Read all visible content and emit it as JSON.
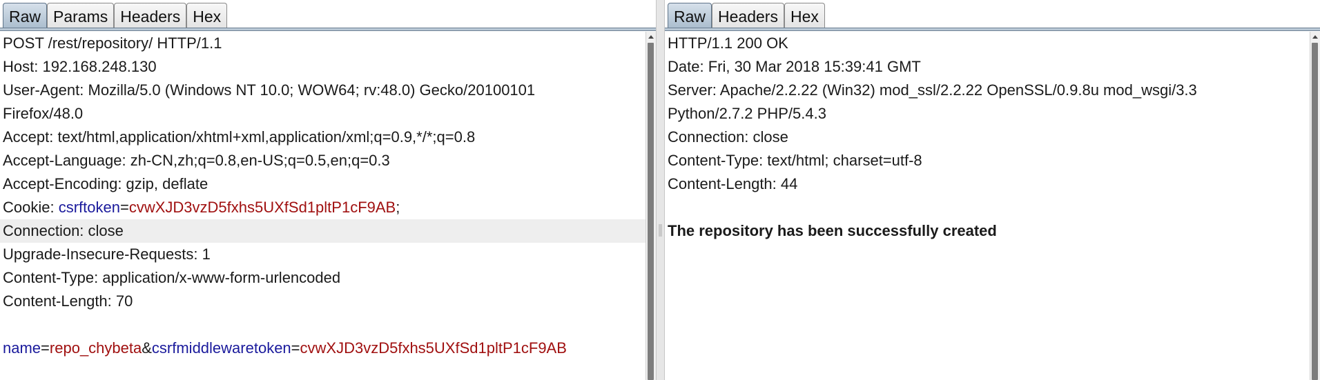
{
  "request": {
    "tabs": [
      "Raw",
      "Params",
      "Headers",
      "Hex"
    ],
    "active_tab": "Raw",
    "lines": {
      "request_line": "POST /rest/repository/ HTTP/1.1",
      "host": "Host: 192.168.248.130",
      "user_agent": "User-Agent: Mozilla/5.0 (Windows NT 10.0; WOW64; rv:48.0) Gecko/20100101",
      "user_agent_cont": "Firefox/48.0",
      "accept": "Accept: text/html,application/xhtml+xml,application/xml;q=0.9,*/*;q=0.8",
      "accept_language": "Accept-Language: zh-CN,zh;q=0.8,en-US;q=0.5,en;q=0.3",
      "accept_encoding": "Accept-Encoding: gzip, deflate",
      "cookie_prefix": "Cookie: ",
      "cookie_name": "csrftoken",
      "cookie_eq": "=",
      "cookie_value": "cvwXJD3vzD5fxhs5UXfSd1pltP1cF9AB",
      "cookie_semicolon": ";",
      "connection": "Connection: close",
      "upgrade": "Upgrade-Insecure-Requests: 1",
      "content_type": "Content-Type: application/x-www-form-urlencoded",
      "content_length": "Content-Length: 70",
      "body_key1": "name",
      "body_eq1": "=",
      "body_val1": "repo_chybeta",
      "body_amp": "&",
      "body_key2": "csrfmiddlewaretoken",
      "body_eq2": "=",
      "body_val2": "cvwXJD3vzD5fxhs5UXfSd1pltP1cF9AB"
    }
  },
  "response": {
    "tabs": [
      "Raw",
      "Headers",
      "Hex"
    ],
    "active_tab": "Raw",
    "lines": {
      "status_line": "HTTP/1.1 200 OK",
      "date": "Date: Fri, 30 Mar 2018 15:39:41 GMT",
      "server": "Server: Apache/2.2.22 (Win32) mod_ssl/2.2.22 OpenSSL/0.9.8u mod_wsgi/3.3",
      "server_cont": "Python/2.7.2 PHP/5.4.3",
      "connection": "Connection: close",
      "content_type": "Content-Type: text/html; charset=utf-8",
      "content_length": "Content-Length: 44",
      "body": "The repository has been successfully created"
    }
  },
  "icons": {
    "scroll_up": "chevron-up-icon"
  }
}
